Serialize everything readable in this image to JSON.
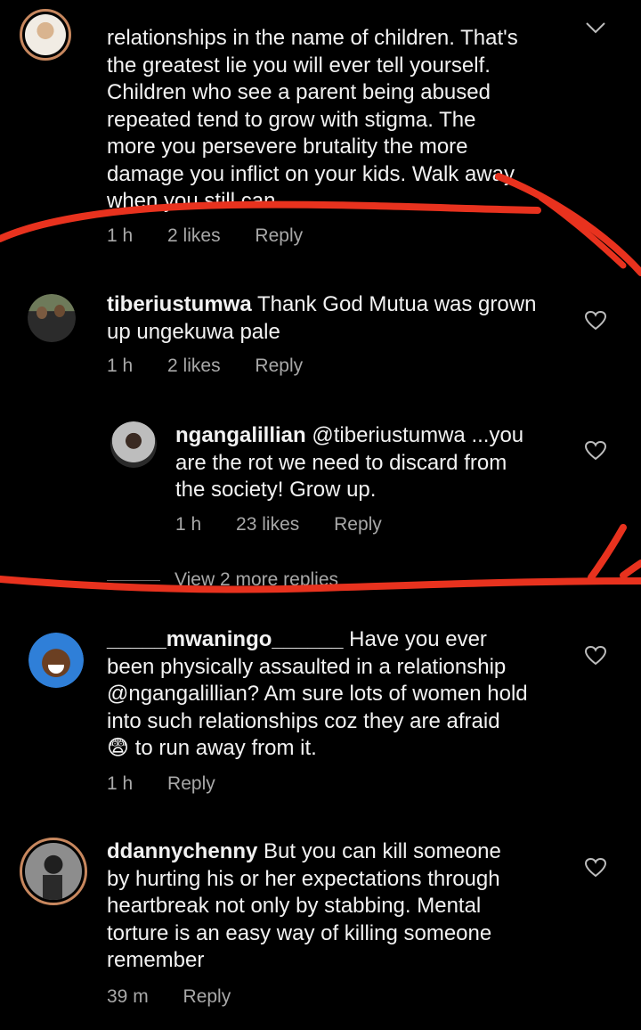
{
  "comments": [
    {
      "username": "",
      "text_lines": [
        "relationships in the name of children.  That's",
        "the greatest lie you will ever tell yourself.",
        "Children who see a parent being abused",
        "repeated tend to grow with stigma. The",
        "more you persevere brutality the more",
        "damage you inflict on your kids. Walk away",
        "when you still can"
      ],
      "time": "1 h",
      "likes": "2 likes",
      "reply": "Reply"
    },
    {
      "username": "tiberiustumwa",
      "first_line": "Thank God Mutua was grown",
      "text_lines": [
        "up  ungekuwa pale"
      ],
      "time": "1 h",
      "likes": "2 likes",
      "reply": "Reply"
    },
    {
      "username": "ngangalillian",
      "first_line": "@tiberiustumwa ...you",
      "text_lines": [
        "are the rot we need to discard from",
        "the society! Grow up."
      ],
      "time": "1 h",
      "likes": "23 likes",
      "reply": "Reply"
    },
    {
      "username": "_____mwaningo______",
      "first_line": "Have you ever",
      "text_lines": [
        "been physically assaulted in a relationship",
        "@ngangalillian? Am sure lots of women hold",
        "into such relationships coz they are afraid"
      ],
      "emoji": "😨",
      "last_line": "to run away from it.",
      "time": "1 h",
      "reply": "Reply"
    },
    {
      "username": "ddannychenny",
      "first_line": "But you can kill someone",
      "text_lines": [
        "by hurting his or her expectations through",
        "heartbreak not only by stabbing. Mental",
        "torture is an easy way of killing someone",
        "remember"
      ],
      "time": "39 m",
      "reply": "Reply"
    }
  ],
  "view_more_replies": "View 2 more replies",
  "icons": {
    "heart": "heart-outline-icon",
    "chevron": "chevron-down-icon"
  },
  "colors": {
    "background": "#000000",
    "text": "#f2f2f2",
    "meta": "#a8a8a8",
    "annotation": "#e8321e",
    "story_ring": "#c7875e"
  }
}
